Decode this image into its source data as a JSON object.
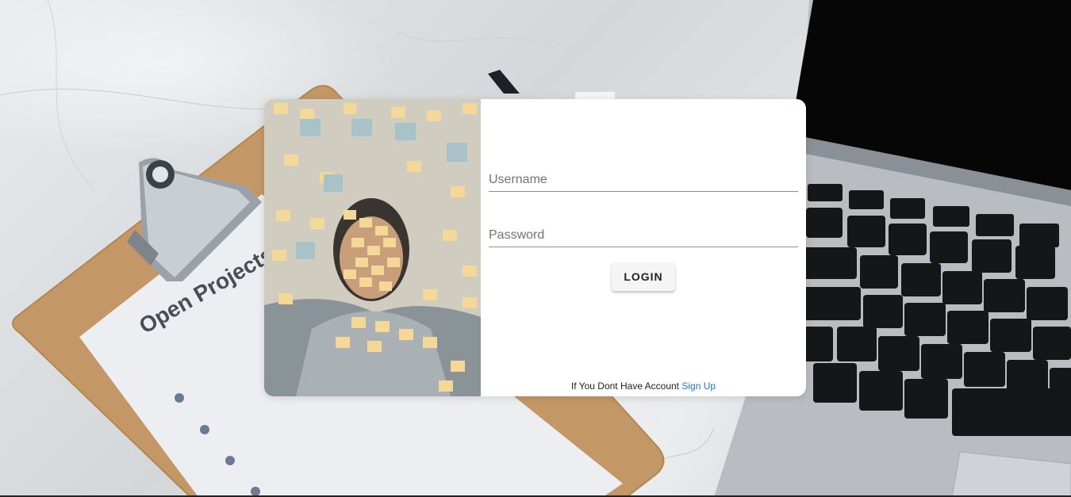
{
  "login": {
    "username_placeholder": "Username",
    "password_placeholder": "Password",
    "login_button": "LOGIN",
    "signup_prompt": "If You Dont Have Account",
    "signup_link": "Sign Up"
  },
  "background": {
    "clipboard_paper_text": "Open Projects"
  },
  "colors": {
    "link": "#1976d2",
    "card": "#ffffff",
    "clipboard": "#c79c68"
  },
  "icons": [
    "clipboard-clip-icon",
    "laptop-icon",
    "pen-icon"
  ]
}
